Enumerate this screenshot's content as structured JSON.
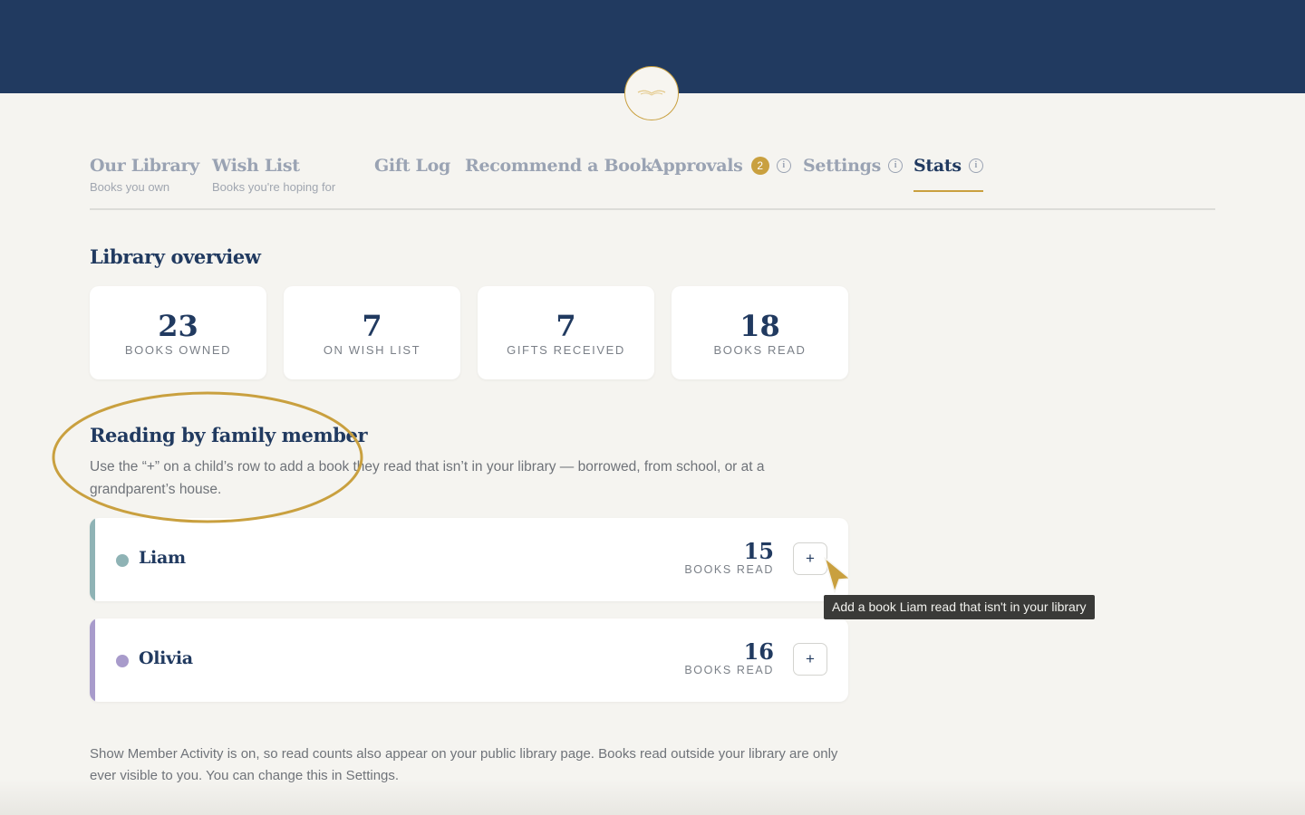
{
  "header": {
    "logo_icon": "open-book-icon"
  },
  "tabs": [
    {
      "label": "Our Library",
      "sub": "Books you own"
    },
    {
      "label": "Wish List",
      "sub": "Books you're hoping for"
    },
    {
      "label": "Gift Log"
    },
    {
      "label": "Recommend a Book"
    },
    {
      "label": "Approvals",
      "badge": "2",
      "info_icon": "info-icon"
    },
    {
      "label": "Settings",
      "info_icon": "info-icon"
    },
    {
      "label": "Stats",
      "info_icon": "info-icon",
      "active": true
    }
  ],
  "overview": {
    "title": "Library overview",
    "stats": [
      {
        "value": "23",
        "label": "BOOKS OWNED"
      },
      {
        "value": "7",
        "label": "ON WISH LIST"
      },
      {
        "value": "7",
        "label": "GIFTS RECEIVED"
      },
      {
        "value": "18",
        "label": "BOOKS READ"
      }
    ]
  },
  "family": {
    "title": "Reading by family member",
    "help_text": "Use the “+” on a child’s row to add a book they read that isn’t in your library — borrowed, from school, or at a grandparent’s house.",
    "members": [
      {
        "name": "Liam",
        "count": "15",
        "count_label": "BOOKS READ",
        "add_label": "+",
        "color": "#8fb3b5"
      },
      {
        "name": "Olivia",
        "count": "16",
        "count_label": "BOOKS READ",
        "add_label": "+",
        "color": "#a89bcb"
      }
    ]
  },
  "tooltip": {
    "text": "Add a book Liam read that isn't in your library"
  },
  "footer": {
    "note": "Show Member Activity is on, so read counts also appear on your public library page. Books read outside your library are only ever visible to you. You can change this in Settings."
  },
  "colors": {
    "navy": "#213a60",
    "gold": "#c9a03f",
    "background": "#f5f4f0"
  }
}
